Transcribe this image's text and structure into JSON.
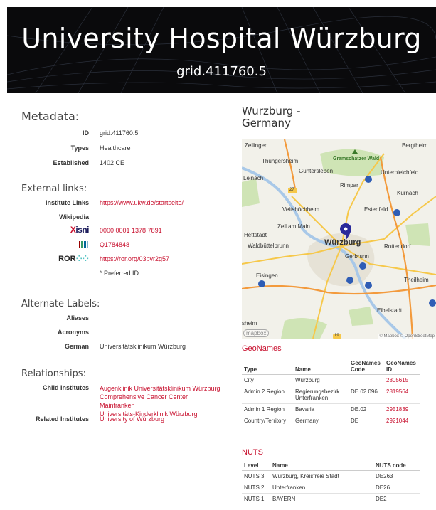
{
  "header": {
    "title": "University Hospital Würzburg",
    "grid_id": "grid.411760.5"
  },
  "metadata": {
    "heading": "Metadata:",
    "rows": [
      {
        "key": "ID",
        "value": "grid.411760.5"
      },
      {
        "key": "Types",
        "value": "Healthcare"
      },
      {
        "key": "Established",
        "value": "1402 CE"
      }
    ]
  },
  "external_links": {
    "heading": "External links:",
    "institute_links_label": "Institute Links",
    "institute_link": "https://www.ukw.de/startseite/",
    "wikipedia_label": "Wikipedia",
    "isni_logo": "isni",
    "isni_value": "0000 0001 1378 7891",
    "wikidata_value": "Q1784848",
    "ror_logo": "ROR",
    "ror_value": "https://ror.org/03pvr2g57",
    "preferred_note": "* Preferred ID"
  },
  "alternate_labels": {
    "heading": "Alternate Labels:",
    "aliases_label": "Aliases",
    "acronyms_label": "Acronyms",
    "german_label": "German",
    "german_value": "Universitätsklinikum Würzburg"
  },
  "relationships": {
    "heading": "Relationships:",
    "child_label": "Child Institutes",
    "children": [
      "Augenklinik Universitätsklinikum Würzburg",
      "Comprehensive Cancer Center Mainfranken",
      "Universitäts-Kinderklinik Würzburg"
    ],
    "related_label": "Related Institutes",
    "related": "University of Würzburg"
  },
  "location": {
    "title_line1": "Wurzburg -",
    "title_line2": "Germany"
  },
  "map": {
    "labels": {
      "zellingen": "Zellingen",
      "bergtheim": "Bergtheim",
      "gramschatzer": "Gramschatzer Wald",
      "thungersheim": "Thüngersheim",
      "guntersleben": "Güntersleben",
      "unterpleichfeld": "Unterpleichfeld",
      "leinach": "Leinach",
      "rimpar": "Rimpar",
      "kurnach": "Kürnach",
      "veitshochheim": "Veitshöchheim",
      "estenfeld": "Estenfeld",
      "zell": "Zell am Main",
      "hettstadt": "Hettstadt",
      "waldbuttelbrunn": "Waldbüttelbrunn",
      "wurzburg": "Würzburg",
      "rottendorf": "Rottendorf",
      "gerbrunn": "Gerbrunn",
      "eisingen": "Eisingen",
      "theilheim": "Theilheim",
      "eibelstadt": "Eibelstadt",
      "sheim": "sheim"
    },
    "road_badges": [
      "27",
      "19"
    ],
    "mapbox_logo": "mapbox",
    "attribution": "© Mapbox © OpenStreetMap"
  },
  "geonames": {
    "heading": "GeoNames",
    "columns": [
      "Type",
      "Name",
      "GeoNames Code",
      "GeoNames ID"
    ],
    "rows": [
      [
        "City",
        "Würzburg",
        "",
        "2805615"
      ],
      [
        "Admin 2 Region",
        "Regierungsbezirk Unterfranken",
        "DE.02.096",
        "2819564"
      ],
      [
        "Admin 1 Region",
        "Bavaria",
        "DE.02",
        "2951839"
      ],
      [
        "Country/Territory",
        "Germany",
        "DE",
        "2921044"
      ]
    ]
  },
  "nuts": {
    "heading": "NUTS",
    "columns": [
      "Level",
      "Name",
      "NUTS code"
    ],
    "rows": [
      [
        "NUTS 3",
        "Würzburg, Kreisfreie Stadt",
        "DE263"
      ],
      [
        "NUTS 2",
        "Unterfranken",
        "DE26"
      ],
      [
        "NUTS 1",
        "BAYERN",
        "DE2"
      ]
    ]
  },
  "colors": {
    "accent": "#c8102e",
    "hero_bg": "#0a0a0c"
  }
}
